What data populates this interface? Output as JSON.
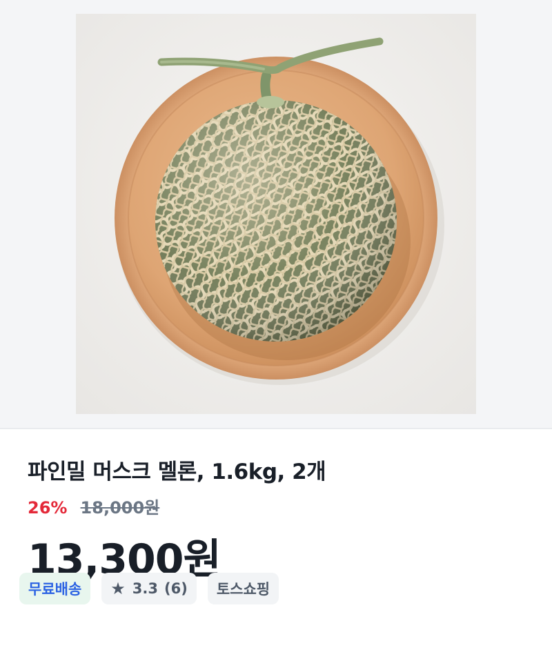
{
  "product": {
    "image_alt": "melon on wooden plate",
    "title": "파인밀 머스크 멜론, 1.6kg, 2개",
    "discount_rate": "26%",
    "original_price": "18,000원",
    "price": "13,300원"
  },
  "badges": {
    "free_shipping": "무료배송",
    "rating": "3.3",
    "review_count": "(6)",
    "store": "토스쇼핑"
  },
  "colors": {
    "discount": "#e42939",
    "free_shipping_text": "#2b62e3",
    "free_shipping_bg": "#e8f6ee",
    "chip_bg": "#f2f4f6"
  },
  "icons": {
    "star": "star-icon"
  }
}
